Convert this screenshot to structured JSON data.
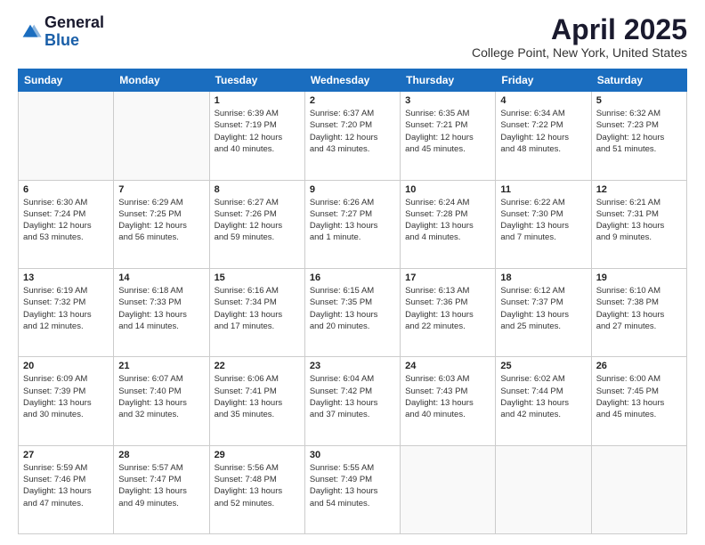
{
  "header": {
    "logo_general": "General",
    "logo_blue": "Blue",
    "month_title": "April 2025",
    "location": "College Point, New York, United States"
  },
  "days_of_week": [
    "Sunday",
    "Monday",
    "Tuesday",
    "Wednesday",
    "Thursday",
    "Friday",
    "Saturday"
  ],
  "weeks": [
    [
      {
        "day": "",
        "info": ""
      },
      {
        "day": "",
        "info": ""
      },
      {
        "day": "1",
        "info": "Sunrise: 6:39 AM\nSunset: 7:19 PM\nDaylight: 12 hours\nand 40 minutes."
      },
      {
        "day": "2",
        "info": "Sunrise: 6:37 AM\nSunset: 7:20 PM\nDaylight: 12 hours\nand 43 minutes."
      },
      {
        "day": "3",
        "info": "Sunrise: 6:35 AM\nSunset: 7:21 PM\nDaylight: 12 hours\nand 45 minutes."
      },
      {
        "day": "4",
        "info": "Sunrise: 6:34 AM\nSunset: 7:22 PM\nDaylight: 12 hours\nand 48 minutes."
      },
      {
        "day": "5",
        "info": "Sunrise: 6:32 AM\nSunset: 7:23 PM\nDaylight: 12 hours\nand 51 minutes."
      }
    ],
    [
      {
        "day": "6",
        "info": "Sunrise: 6:30 AM\nSunset: 7:24 PM\nDaylight: 12 hours\nand 53 minutes."
      },
      {
        "day": "7",
        "info": "Sunrise: 6:29 AM\nSunset: 7:25 PM\nDaylight: 12 hours\nand 56 minutes."
      },
      {
        "day": "8",
        "info": "Sunrise: 6:27 AM\nSunset: 7:26 PM\nDaylight: 12 hours\nand 59 minutes."
      },
      {
        "day": "9",
        "info": "Sunrise: 6:26 AM\nSunset: 7:27 PM\nDaylight: 13 hours\nand 1 minute."
      },
      {
        "day": "10",
        "info": "Sunrise: 6:24 AM\nSunset: 7:28 PM\nDaylight: 13 hours\nand 4 minutes."
      },
      {
        "day": "11",
        "info": "Sunrise: 6:22 AM\nSunset: 7:30 PM\nDaylight: 13 hours\nand 7 minutes."
      },
      {
        "day": "12",
        "info": "Sunrise: 6:21 AM\nSunset: 7:31 PM\nDaylight: 13 hours\nand 9 minutes."
      }
    ],
    [
      {
        "day": "13",
        "info": "Sunrise: 6:19 AM\nSunset: 7:32 PM\nDaylight: 13 hours\nand 12 minutes."
      },
      {
        "day": "14",
        "info": "Sunrise: 6:18 AM\nSunset: 7:33 PM\nDaylight: 13 hours\nand 14 minutes."
      },
      {
        "day": "15",
        "info": "Sunrise: 6:16 AM\nSunset: 7:34 PM\nDaylight: 13 hours\nand 17 minutes."
      },
      {
        "day": "16",
        "info": "Sunrise: 6:15 AM\nSunset: 7:35 PM\nDaylight: 13 hours\nand 20 minutes."
      },
      {
        "day": "17",
        "info": "Sunrise: 6:13 AM\nSunset: 7:36 PM\nDaylight: 13 hours\nand 22 minutes."
      },
      {
        "day": "18",
        "info": "Sunrise: 6:12 AM\nSunset: 7:37 PM\nDaylight: 13 hours\nand 25 minutes."
      },
      {
        "day": "19",
        "info": "Sunrise: 6:10 AM\nSunset: 7:38 PM\nDaylight: 13 hours\nand 27 minutes."
      }
    ],
    [
      {
        "day": "20",
        "info": "Sunrise: 6:09 AM\nSunset: 7:39 PM\nDaylight: 13 hours\nand 30 minutes."
      },
      {
        "day": "21",
        "info": "Sunrise: 6:07 AM\nSunset: 7:40 PM\nDaylight: 13 hours\nand 32 minutes."
      },
      {
        "day": "22",
        "info": "Sunrise: 6:06 AM\nSunset: 7:41 PM\nDaylight: 13 hours\nand 35 minutes."
      },
      {
        "day": "23",
        "info": "Sunrise: 6:04 AM\nSunset: 7:42 PM\nDaylight: 13 hours\nand 37 minutes."
      },
      {
        "day": "24",
        "info": "Sunrise: 6:03 AM\nSunset: 7:43 PM\nDaylight: 13 hours\nand 40 minutes."
      },
      {
        "day": "25",
        "info": "Sunrise: 6:02 AM\nSunset: 7:44 PM\nDaylight: 13 hours\nand 42 minutes."
      },
      {
        "day": "26",
        "info": "Sunrise: 6:00 AM\nSunset: 7:45 PM\nDaylight: 13 hours\nand 45 minutes."
      }
    ],
    [
      {
        "day": "27",
        "info": "Sunrise: 5:59 AM\nSunset: 7:46 PM\nDaylight: 13 hours\nand 47 minutes."
      },
      {
        "day": "28",
        "info": "Sunrise: 5:57 AM\nSunset: 7:47 PM\nDaylight: 13 hours\nand 49 minutes."
      },
      {
        "day": "29",
        "info": "Sunrise: 5:56 AM\nSunset: 7:48 PM\nDaylight: 13 hours\nand 52 minutes."
      },
      {
        "day": "30",
        "info": "Sunrise: 5:55 AM\nSunset: 7:49 PM\nDaylight: 13 hours\nand 54 minutes."
      },
      {
        "day": "",
        "info": ""
      },
      {
        "day": "",
        "info": ""
      },
      {
        "day": "",
        "info": ""
      }
    ]
  ]
}
